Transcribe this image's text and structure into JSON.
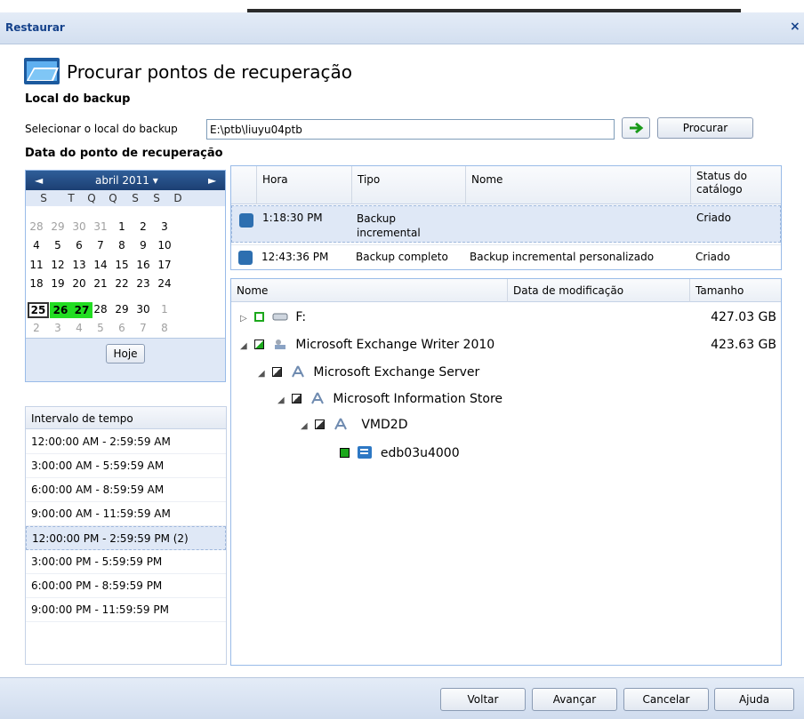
{
  "window": {
    "title": "Restaurar",
    "close": "×"
  },
  "header": {
    "title": "Procurar pontos de recuperação"
  },
  "backup_location": {
    "section_label": "Local do backup",
    "select_label": "Selecionar o local do backup",
    "path_value": "E:\\ptb\\liuyu04ptb",
    "go_icon": "arrow-right-icon",
    "browse_label": "Procurar"
  },
  "recovery_date": {
    "section_label": "Data do ponto de recuperação"
  },
  "calendar": {
    "prev": "◄",
    "next": "►",
    "month_label": "abril 2011 ▾",
    "weekdays": [
      "S",
      "T",
      "Q",
      "Q",
      "S",
      "S",
      "D"
    ],
    "weeks": [
      [
        "28",
        "29",
        "30",
        "31",
        "1",
        "2",
        "3"
      ],
      [
        "4",
        "5",
        "6",
        "7",
        "8",
        "9",
        "10"
      ],
      [
        "11",
        "12",
        "13",
        "14",
        "15",
        "16",
        "17"
      ],
      [
        "18",
        "19",
        "20",
        "21",
        "22",
        "23",
        "24"
      ],
      [
        "25",
        "26",
        "27",
        "28",
        "29",
        "30",
        "1"
      ],
      [
        "2",
        "3",
        "4",
        "5",
        "6",
        "7",
        "8"
      ]
    ],
    "today_label": "Hoje",
    "highlight_color": "#22dd22"
  },
  "time_ranges": {
    "header": "Intervalo de tempo",
    "items": [
      "12:00:00 AM - 2:59:59 AM",
      "3:00:00 AM - 5:59:59 AM",
      "6:00:00 AM - 8:59:59 AM",
      "9:00:00 AM - 11:59:59 AM",
      "12:00:00 PM - 2:59:59 PM (2)",
      "3:00:00 PM - 5:59:59 PM",
      "6:00:00 PM - 8:59:59 PM",
      "9:00:00 PM - 11:59:59 PM"
    ]
  },
  "recovery_points": {
    "columns": [
      "Hora",
      "Tipo",
      "Nome",
      "Status do catálogo"
    ],
    "rows": [
      {
        "time": "1:18:30 PM",
        "type": "Backup incremental",
        "name": "",
        "status": "Criado"
      },
      {
        "time": "12:43:36 PM",
        "type": "Backup completo",
        "name": "Backup incremental personalizado",
        "status": "Criado"
      }
    ]
  },
  "tree": {
    "columns": [
      "Nome",
      "Data de modificação",
      "Tamanho"
    ],
    "nodes": [
      {
        "label": "F:",
        "size": "427.03 GB",
        "icon": "drive-icon"
      },
      {
        "label": "Microsoft Exchange Writer 2010",
        "size": "423.63 GB",
        "icon": "exchange-writer-icon"
      },
      {
        "label": "Microsoft Exchange Server",
        "size": "",
        "icon": "exchange-server-icon"
      },
      {
        "label": "Microsoft Information Store",
        "size": "",
        "icon": "information-store-icon"
      },
      {
        "label": "VMD2D",
        "size": "",
        "icon": "storage-group-icon"
      },
      {
        "label": "edb03u4000",
        "size": "",
        "icon": "database-icon"
      }
    ]
  },
  "footer": {
    "back": "Voltar",
    "next": "Avançar",
    "cancel": "Cancelar",
    "help": "Ajuda"
  }
}
